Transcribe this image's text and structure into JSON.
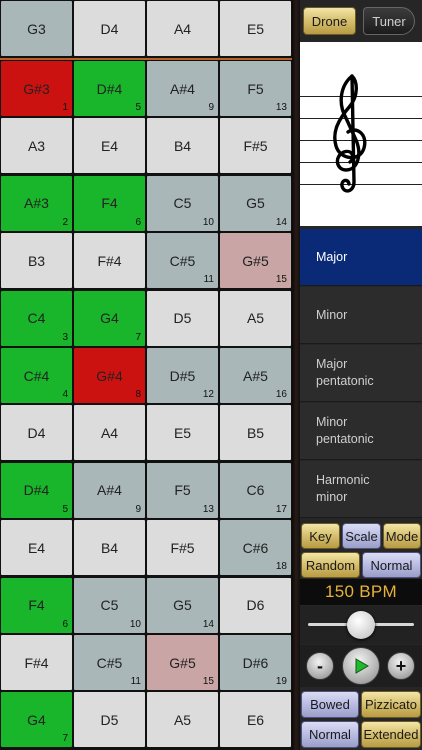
{
  "grid": {
    "rows": [
      [
        {
          "n": "G3",
          "c": "grey",
          "k": ""
        },
        {
          "n": "D4",
          "c": "light",
          "k": ""
        },
        {
          "n": "A4",
          "c": "light",
          "k": ""
        },
        {
          "n": "E5",
          "c": "light",
          "k": ""
        }
      ],
      [
        {
          "n": "G#3",
          "c": "red",
          "k": "1"
        },
        {
          "n": "D#4",
          "c": "green",
          "k": "5"
        },
        {
          "n": "A#4",
          "c": "grey",
          "k": "9"
        },
        {
          "n": "F5",
          "c": "grey",
          "k": "13"
        }
      ],
      [
        {
          "n": "A3",
          "c": "light",
          "k": ""
        },
        {
          "n": "E4",
          "c": "light",
          "k": ""
        },
        {
          "n": "B4",
          "c": "light",
          "k": ""
        },
        {
          "n": "F#5",
          "c": "light",
          "k": ""
        }
      ],
      [
        {
          "n": "A#3",
          "c": "green",
          "k": "2"
        },
        {
          "n": "F4",
          "c": "green",
          "k": "6"
        },
        {
          "n": "C5",
          "c": "grey",
          "k": "10"
        },
        {
          "n": "G5",
          "c": "grey",
          "k": "14"
        }
      ],
      [
        {
          "n": "B3",
          "c": "light",
          "k": ""
        },
        {
          "n": "F#4",
          "c": "light",
          "k": ""
        },
        {
          "n": "C#5",
          "c": "grey",
          "k": "11"
        },
        {
          "n": "G#5",
          "c": "pink",
          "k": "15"
        }
      ],
      [
        {
          "n": "C4",
          "c": "green",
          "k": "3"
        },
        {
          "n": "G4",
          "c": "green",
          "k": "7"
        },
        {
          "n": "D5",
          "c": "light",
          "k": ""
        },
        {
          "n": "A5",
          "c": "light",
          "k": ""
        }
      ],
      [
        {
          "n": "C#4",
          "c": "green",
          "k": "4"
        },
        {
          "n": "G#4",
          "c": "red",
          "k": "8"
        },
        {
          "n": "D#5",
          "c": "grey",
          "k": "12"
        },
        {
          "n": "A#5",
          "c": "grey",
          "k": "16"
        }
      ],
      [
        {
          "n": "D4",
          "c": "light",
          "k": ""
        },
        {
          "n": "A4",
          "c": "light",
          "k": ""
        },
        {
          "n": "E5",
          "c": "light",
          "k": ""
        },
        {
          "n": "B5",
          "c": "light",
          "k": ""
        }
      ],
      [
        {
          "n": "D#4",
          "c": "green",
          "k": "5"
        },
        {
          "n": "A#4",
          "c": "grey",
          "k": "9"
        },
        {
          "n": "F5",
          "c": "grey",
          "k": "13"
        },
        {
          "n": "C6",
          "c": "grey",
          "k": "17"
        }
      ],
      [
        {
          "n": "E4",
          "c": "light",
          "k": ""
        },
        {
          "n": "B4",
          "c": "light",
          "k": ""
        },
        {
          "n": "F#5",
          "c": "light",
          "k": ""
        },
        {
          "n": "C#6",
          "c": "grey",
          "k": "18"
        }
      ],
      [
        {
          "n": "F4",
          "c": "green",
          "k": "6"
        },
        {
          "n": "C5",
          "c": "grey",
          "k": "10"
        },
        {
          "n": "G5",
          "c": "grey",
          "k": "14"
        },
        {
          "n": "D6",
          "c": "light",
          "k": ""
        }
      ],
      [
        {
          "n": "F#4",
          "c": "light",
          "k": ""
        },
        {
          "n": "C#5",
          "c": "grey",
          "k": "11"
        },
        {
          "n": "G#5",
          "c": "pink",
          "k": "15"
        },
        {
          "n": "D#6",
          "c": "grey",
          "k": "19"
        }
      ],
      [
        {
          "n": "G4",
          "c": "green",
          "k": "7"
        },
        {
          "n": "D5",
          "c": "light",
          "k": ""
        },
        {
          "n": "A5",
          "c": "light",
          "k": ""
        },
        {
          "n": "E6",
          "c": "light",
          "k": ""
        }
      ]
    ]
  },
  "colors": {
    "light": "#dcdcdc",
    "grey": "#a9b7b8",
    "green": "#19b52a",
    "red": "#cc1111",
    "pink": "#c9a5a5",
    "selected_scale": "#0a2a78",
    "bpm_text": "#e5b23a"
  },
  "top_tabs": {
    "drone": "Drone",
    "tuner": "Tuner"
  },
  "staff": {
    "clef_icon": "treble-clef-icon"
  },
  "scales": [
    {
      "label": "Major",
      "selected": true
    },
    {
      "label": "Minor",
      "selected": false
    },
    {
      "label": "Major\npentatonic",
      "selected": false
    },
    {
      "label": "Minor\npentatonic",
      "selected": false
    },
    {
      "label": "Harmonic\nminor",
      "selected": false
    }
  ],
  "mode_tabs": {
    "key": "Key",
    "scale": "Scale",
    "mode": "Mode"
  },
  "order": {
    "random": "Random",
    "normal": "Normal"
  },
  "tempo": {
    "label": "150 BPM",
    "slider_fraction": 0.5
  },
  "transport": {
    "minus": "-",
    "plus": "+",
    "play_icon": "play-icon"
  },
  "articulation": {
    "bowed": "Bowed",
    "pizzicato": "Pizzicato"
  },
  "range": {
    "normal": "Normal",
    "extended": "Extended"
  }
}
